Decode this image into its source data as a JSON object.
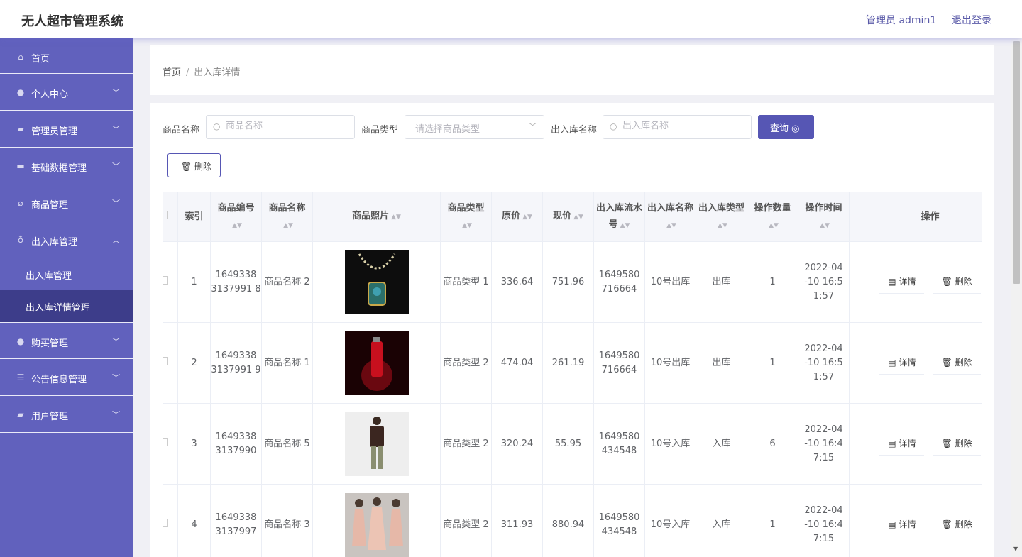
{
  "app": {
    "title": "无人超市管理系统"
  },
  "header": {
    "user": "管理员 admin1",
    "logout": "退出登录"
  },
  "sidebar": {
    "items": [
      {
        "label": "首页",
        "icon": "home-icon"
      },
      {
        "label": "个人中心",
        "icon": "user-icon"
      },
      {
        "label": "管理员管理",
        "icon": "admin-icon"
      },
      {
        "label": "基础数据管理",
        "icon": "data-icon"
      },
      {
        "label": "商品管理",
        "icon": "goods-icon"
      },
      {
        "label": "出入库管理",
        "icon": "mic-icon"
      },
      {
        "label": "购买管理",
        "icon": "cart-icon"
      },
      {
        "label": "公告信息管理",
        "icon": "list-icon"
      },
      {
        "label": "用户管理",
        "icon": "users-icon"
      }
    ],
    "submenu": [
      {
        "label": "出入库管理"
      },
      {
        "label": "出入库详情管理"
      }
    ]
  },
  "breadcrumb": {
    "home": "首页",
    "separator": "/",
    "current": "出入库详情"
  },
  "search": {
    "name_label": "商品名称",
    "name_placeholder": "商品名称",
    "type_label": "商品类型",
    "type_placeholder": "请选择商品类型",
    "io_label": "出入库名称",
    "io_placeholder": "出入库名称",
    "query_button": "查询 ◎"
  },
  "toolbar": {
    "delete_button": "🗑 删除"
  },
  "table": {
    "headers": {
      "index": "索引",
      "code": "商品编号",
      "name": "商品名称",
      "photo": "商品照片",
      "type": "商品类型",
      "orig_price": "原价",
      "price": "现价",
      "serial": "出入库流水号",
      "io_name": "出入库名称",
      "io_type": "出入库类型",
      "qty": "操作数量",
      "time": "操作时间",
      "ops": "操作"
    },
    "rows": [
      {
        "index": "1",
        "code": "1649338 3137991 8",
        "name": "商品名称 2",
        "type": "商品类型 1",
        "orig_price": "336.64",
        "price": "751.96",
        "serial": "1649580 716664",
        "io_name": "10号出库",
        "io_type": "出库",
        "qty": "1",
        "time": "2022-04 -10 16:5 1:57",
        "detail": "详情",
        "delete": "删除"
      },
      {
        "index": "2",
        "code": "1649338 3137991 9",
        "name": "商品名称 1",
        "type": "商品类型 2",
        "orig_price": "474.04",
        "price": "261.19",
        "serial": "1649580 716664",
        "io_name": "10号出库",
        "io_type": "出库",
        "qty": "1",
        "time": "2022-04 -10 16:5 1:57",
        "detail": "详情",
        "delete": "删除"
      },
      {
        "index": "3",
        "code": "1649338 3137990",
        "name": "商品名称 5",
        "type": "商品类型 2",
        "orig_price": "320.24",
        "price": "55.95",
        "serial": "1649580 434548",
        "io_name": "10号入库",
        "io_type": "入库",
        "qty": "6",
        "time": "2022-04 -10 16:4 7:15",
        "detail": "详情",
        "delete": "删除"
      },
      {
        "index": "4",
        "code": "1649338 3137997",
        "name": "商品名称 3",
        "type": "商品类型 2",
        "orig_price": "311.93",
        "price": "880.94",
        "serial": "1649580 434548",
        "io_name": "10号入库",
        "io_type": "入库",
        "qty": "1",
        "time": "2022-04 -10 16:4 7:15",
        "detail": "详情",
        "delete": "删除"
      }
    ]
  },
  "colors": {
    "sidebar": "#6161bd",
    "sidebar_active": "#3d3d8a",
    "accent": "#5656b4"
  }
}
